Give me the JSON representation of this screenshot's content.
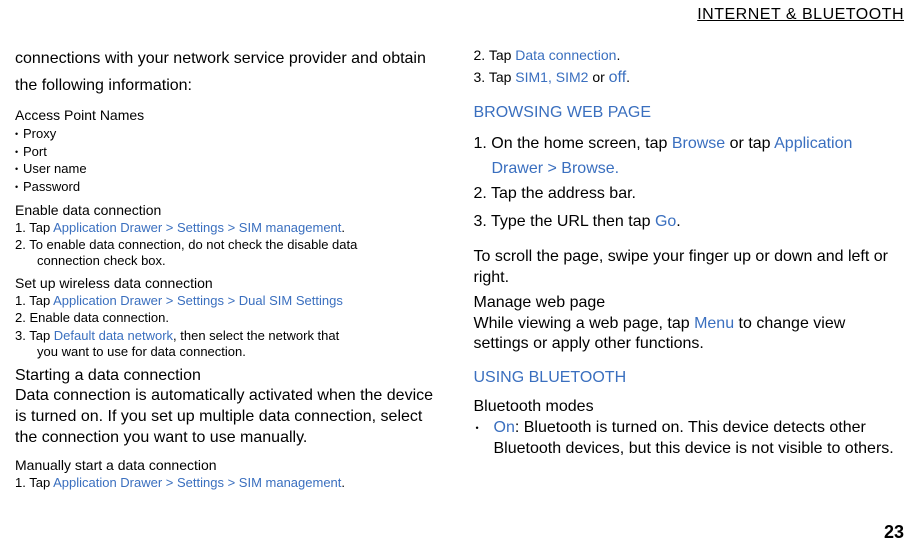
{
  "header": "INTERNET & BLUETOOTH",
  "pageNumber": "23",
  "left": {
    "intro": "connections with your network service provider and obtain the following information:",
    "apnHeading": "Access Point Names",
    "apnItems": [
      "Proxy",
      "Port",
      "User name",
      "Password"
    ],
    "enableHeading": "Enable data connection",
    "enable1_pre": "1. Tap ",
    "enable1_link": "Application Drawer > Settings > SIM management",
    "enable1_post": ".",
    "enable2": "2. To enable data connection, do not check the disable data",
    "enable2b": "connection check box.",
    "setupHeading": "Set up wireless data connection",
    "setup1_pre": "1. Tap ",
    "setup1_link": "Application Drawer > Settings > Dual SIM Settings",
    "setup2": "2. Enable data connection.",
    "setup3_pre": "3. Tap ",
    "setup3_link": "Default data network",
    "setup3_post": ", then select the network that",
    "setup3b": "you want to use for data connection.",
    "startHeading": "Starting a data connection",
    "startBody": "Data connection is automatically activated when the device is turned on. If you set up multiple data connection, select the connection you want to use manually.",
    "manualHeading": "Manually start a data connection",
    "manual1_pre": "1. Tap ",
    "manual1_link": "Application Drawer > Settings > SIM management",
    "manual1_post": "."
  },
  "right": {
    "line2_pre": "2. Tap ",
    "line2_link": "Data connection",
    "line2_post": ".",
    "line3_pre": "3. Tap ",
    "line3_link": "SIM1, SIM2 ",
    "line3_mid": "or ",
    "line3_off": "off",
    "line3_post": ".",
    "browseHeading": "BROWSING WEB PAGE",
    "b1_pre": "1. On the home screen, tap ",
    "b1_link1": "Browse",
    "b1_mid": " or tap ",
    "b1_link2": "Application",
    "b1_line2": "Drawer > Browse.",
    "b2": "2. Tap the address bar.",
    "b3_pre": "3. Type the URL then tap ",
    "b3_link": "Go",
    "b3_post": ".",
    "scroll": "To scroll the page, swipe your finger up or down and left or right.",
    "manageHeading": "Manage web page",
    "manageBody_pre": "While viewing a web page, tap ",
    "manageBody_link": "Menu",
    "manageBody_post": " to change view settings or apply other functions.",
    "btHeading": "USING BLUETOOTH",
    "btModes": "Bluetooth modes",
    "btOn_link": "On",
    "btOn_post": ": Bluetooth is turned on. This device detects other Bluetooth devices, but this device is not visible to others."
  }
}
